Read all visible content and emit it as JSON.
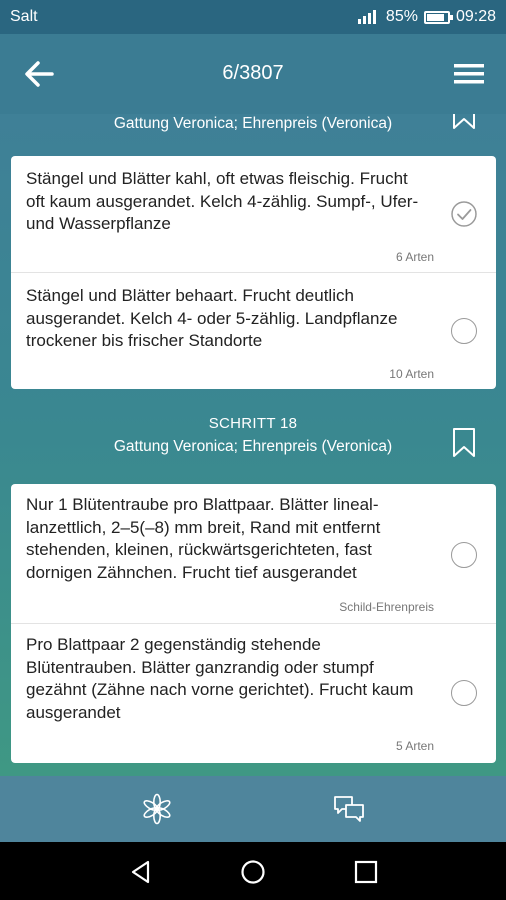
{
  "statusbar": {
    "carrier": "Salt",
    "battery": "85%",
    "battery_level": 0.85,
    "time": "09:28"
  },
  "header": {
    "counter": "6/3807"
  },
  "step_prev": {
    "genus": "Gattung Veronica; Ehrenpreis (Veronica)",
    "options": [
      {
        "text": "Stängel und Blätter kahl, oft etwas fleischig. Frucht oft kaum ausgerandet. Kelch 4-zählig. Sumpf-, Ufer- und Wasserpflanze",
        "count": "6 Arten",
        "selected": true
      },
      {
        "text": "Stängel und Blätter behaart. Frucht deutlich ausgerandet. Kelch 4- oder 5-zählig. Landpflanze trockener bis frischer Standorte",
        "count": "10 Arten",
        "selected": false
      }
    ]
  },
  "step18": {
    "label": "SCHRITT 18",
    "genus": "Gattung Veronica; Ehrenpreis (Veronica)",
    "options": [
      {
        "text": "Nur 1 Blütentraube pro Blattpaar. Blätter lineal-lanzettlich, 2–5(–8) mm breit, Rand mit entfernt stehenden, kleinen, rückwärtsgerichteten, fast dornigen Zähnchen. Frucht tief ausgerandet",
        "count": "Schild-Ehrenpreis",
        "selected": false
      },
      {
        "text": "Pro Blattpaar 2 gegenständig stehende Blütentrauben. Blätter ganzrandig oder stumpf gezähnt (Zähne nach vorne gerichtet). Frucht kaum ausgerandet",
        "count": "5 Arten",
        "selected": false
      }
    ]
  },
  "icons": {
    "back": "arrow-back-icon",
    "menu": "hamburger-menu-icon",
    "bookmark": "bookmark-icon",
    "check": "check-circle-icon",
    "flower": "flower-icon",
    "chat": "chat-icon",
    "nav_back": "nav-back-icon",
    "nav_home": "nav-home-icon",
    "nav_recent": "nav-recent-icon"
  },
  "colors": {
    "statusbar": "#2a6680",
    "appbar": "#3b7c93",
    "bottombar": "#4f859c",
    "card": "#ffffff"
  }
}
